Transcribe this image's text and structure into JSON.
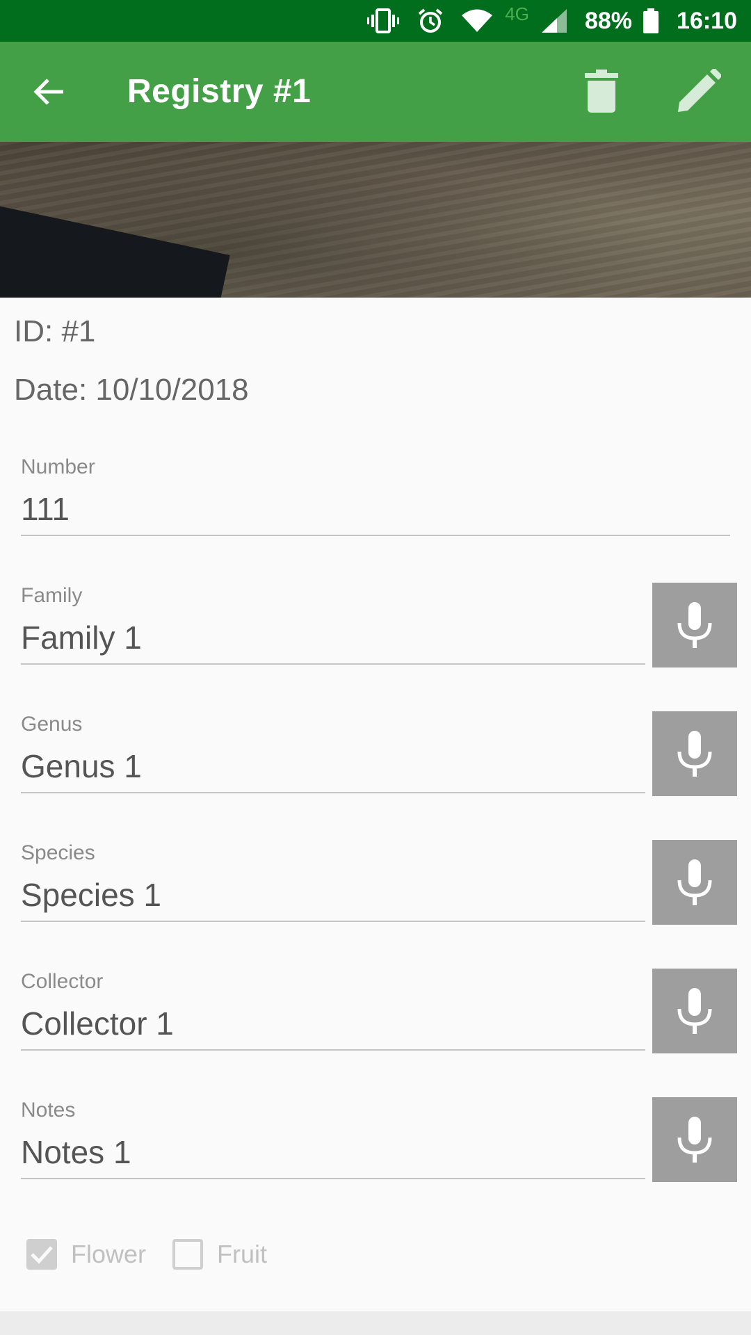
{
  "status_bar": {
    "network_label": "4G",
    "battery_percent": "88%",
    "time": "16:10"
  },
  "app_bar": {
    "title": "Registry #1"
  },
  "info": {
    "id_text": "ID: #1",
    "date_text": "Date: 10/10/2018"
  },
  "fields": {
    "number": {
      "label": "Number",
      "value": "111"
    },
    "family": {
      "label": "Family",
      "value": "Family 1"
    },
    "genus": {
      "label": "Genus",
      "value": "Genus 1"
    },
    "species": {
      "label": "Species",
      "value": "Species 1"
    },
    "collector": {
      "label": "Collector",
      "value": "Collector 1"
    },
    "notes": {
      "label": "Notes",
      "value": "Notes 1"
    }
  },
  "checkboxes": {
    "flower": {
      "label": "Flower",
      "checked": true
    },
    "fruit": {
      "label": "Fruit",
      "checked": false
    }
  },
  "colors": {
    "status_bar": "#006e1c",
    "app_bar": "#43a047",
    "mic_button": "#9e9e9e"
  }
}
